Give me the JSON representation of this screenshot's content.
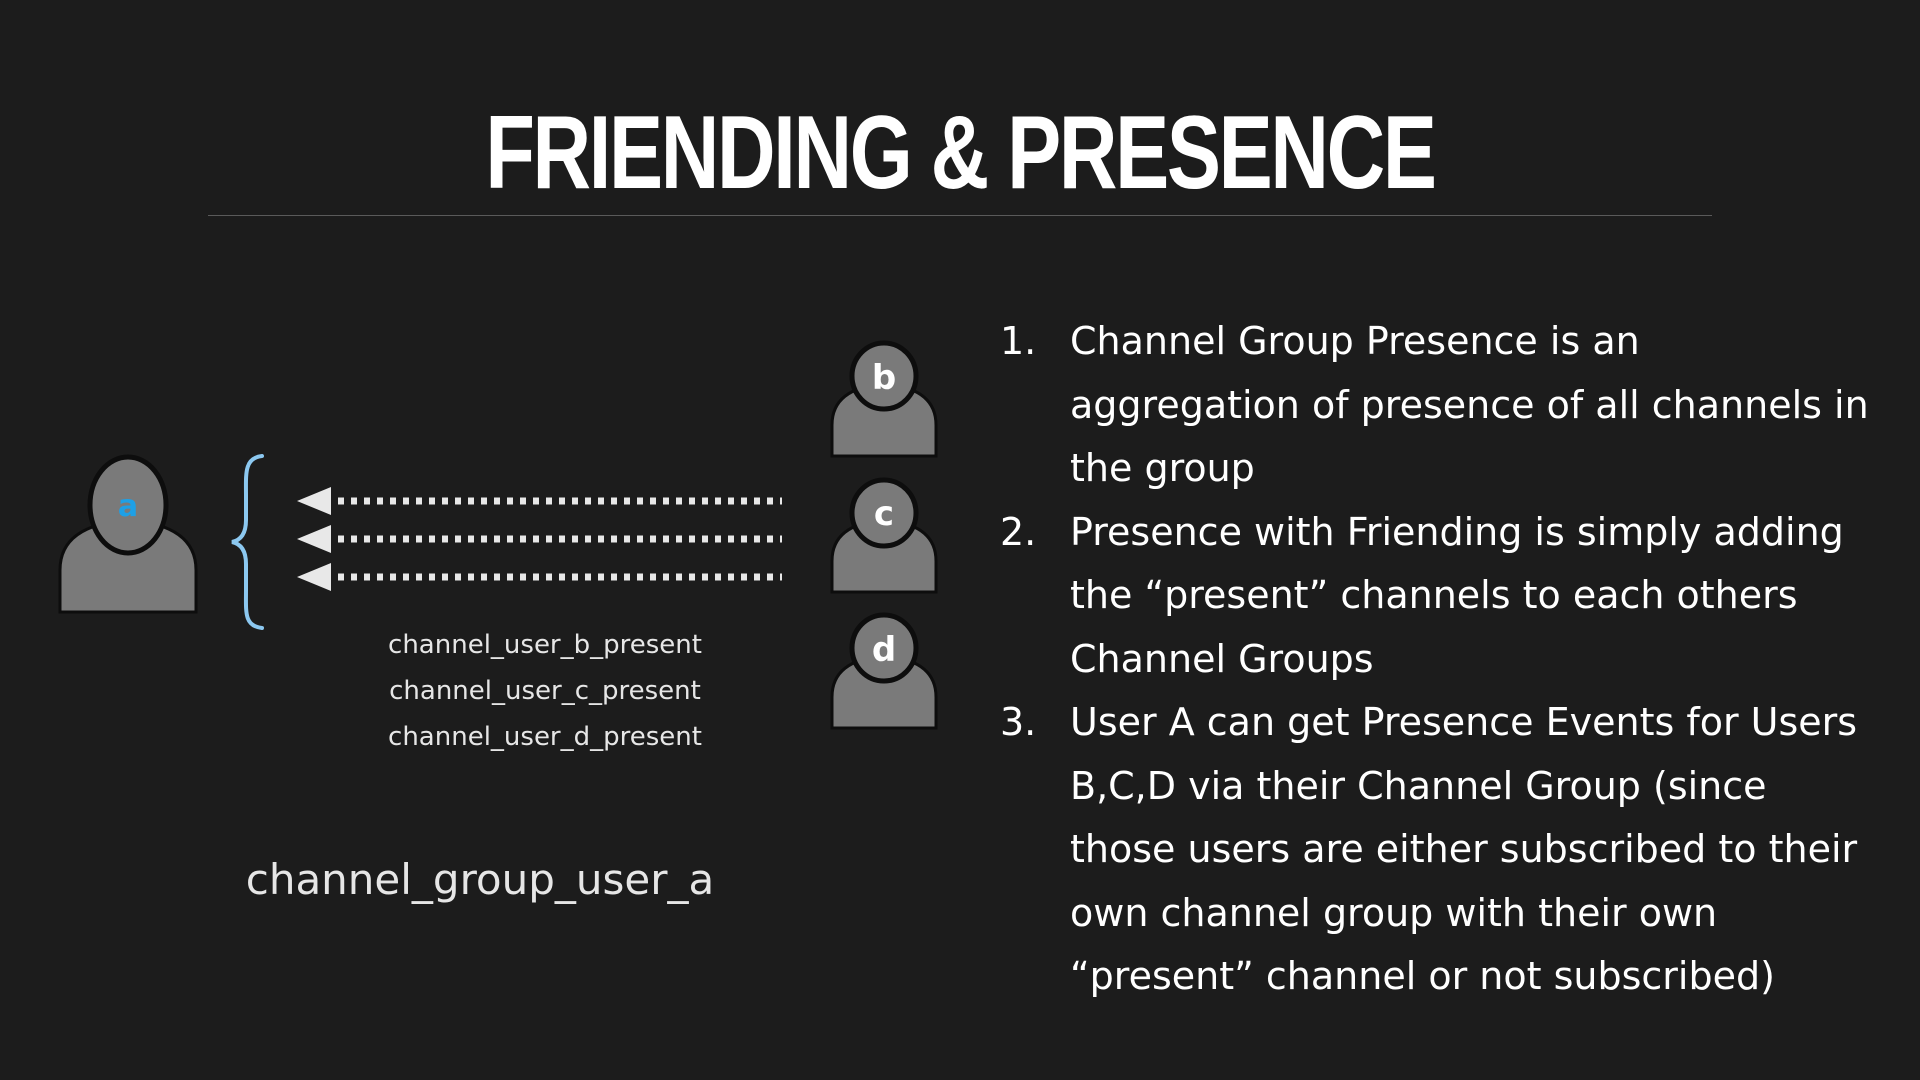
{
  "slide": {
    "title": "FRIENDING & PRESENCE"
  },
  "diagram": {
    "subscriber": {
      "label": "a"
    },
    "friends": [
      {
        "label": "b"
      },
      {
        "label": "c"
      },
      {
        "label": "d"
      }
    ],
    "channels": [
      "channel_user_b_present",
      "channel_user_c_present",
      "channel_user_d_present"
    ],
    "group_name": "channel_group_user_a"
  },
  "points": [
    {
      "num": "1.",
      "text": "Channel Group Presence is an aggregation of presence of all channels in the group"
    },
    {
      "num": "2.",
      "text": "Presence with Friending is simply adding the “present” channels to each others Channel Groups"
    },
    {
      "num": "3.",
      "text": "User A can get Presence Events for Users B,C,D via their Channel Group (since those users are either subscribed to their own channel group with their own “present” channel or not subscribed)"
    }
  ],
  "colors": {
    "background": "#1c1c1c",
    "avatar": "#7a7a7a",
    "avatar_outline": "#0d0d0d",
    "accent_label": "#1ea0e6",
    "brace": "#8cc8f0",
    "arrow": "#e8e8e8"
  }
}
